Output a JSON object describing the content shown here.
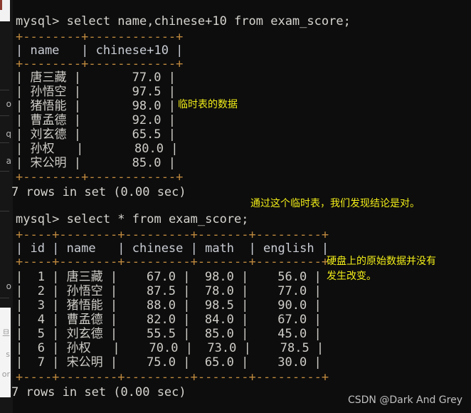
{
  "terminal": {
    "prompt": "mysql> ",
    "query1": "select name,chinese+10 from exam_score;",
    "query2": "select * from exam_score;",
    "status1": "7 rows in set (0.00 sec)",
    "status2": "7 rows in set (0.00 sec)"
  },
  "table1": {
    "top_rule": "+--------+------------+",
    "header_row": "| name   | chinese+10 |",
    "mid_rule": "+--------+------------+",
    "bottom_rule": "+--------+------------+",
    "headers": [
      "name",
      "chinese+10"
    ],
    "rows": [
      {
        "line": "| 唐三藏 |       77.0 |",
        "name": "唐三藏",
        "value": "77.0"
      },
      {
        "line": "| 孙悟空 |       97.5 |",
        "name": "孙悟空",
        "value": "97.5"
      },
      {
        "line": "| 猪悟能 |       98.0 |",
        "name": "猪悟能",
        "value": "98.0"
      },
      {
        "line": "| 曹孟德 |       92.0 |",
        "name": "曹孟德",
        "value": "92.0"
      },
      {
        "line": "| 刘玄德 |       65.5 |",
        "name": "刘玄德",
        "value": "65.5"
      },
      {
        "line": "| 孙权   |       80.0 |",
        "name": "孙权",
        "value": "80.0"
      },
      {
        "line": "| 宋公明 |       85.0 |",
        "name": "宋公明",
        "value": "85.0"
      }
    ]
  },
  "table2": {
    "top_rule": "+----+--------+---------+-------+---------+",
    "header_row": "| id | name   | chinese | math  | english |",
    "mid_rule": "+----+--------+---------+-------+---------+",
    "bottom_rule": "+----+--------+---------+-------+---------+",
    "headers": [
      "id",
      "name",
      "chinese",
      "math",
      "english"
    ],
    "rows": [
      {
        "line": "|  1 | 唐三藏 |    67.0 |  98.0 |    56.0 |",
        "id": "1",
        "name": "唐三藏",
        "chinese": "67.0",
        "math": "98.0",
        "english": "56.0"
      },
      {
        "line": "|  2 | 孙悟空 |    87.5 |  78.0 |    77.0 |",
        "id": "2",
        "name": "孙悟空",
        "chinese": "87.5",
        "math": "78.0",
        "english": "77.0"
      },
      {
        "line": "|  3 | 猪悟能 |    88.0 |  98.5 |    90.0 |",
        "id": "3",
        "name": "猪悟能",
        "chinese": "88.0",
        "math": "98.5",
        "english": "90.0"
      },
      {
        "line": "|  4 | 曹孟德 |    82.0 |  84.0 |    67.0 |",
        "id": "4",
        "name": "曹孟德",
        "chinese": "82.0",
        "math": "84.0",
        "english": "67.0"
      },
      {
        "line": "|  5 | 刘玄德 |    55.5 |  85.0 |    45.0 |",
        "id": "5",
        "name": "刘玄德",
        "chinese": "55.5",
        "math": "85.0",
        "english": "45.0"
      },
      {
        "line": "|  6 | 孙权   |    70.0 |  73.0 |    78.5 |",
        "id": "6",
        "name": "孙权",
        "chinese": "70.0",
        "math": "73.0",
        "english": "78.5"
      },
      {
        "line": "|  7 | 宋公明 |    75.0 |  65.0 |    30.0 |",
        "id": "7",
        "name": "宋公明",
        "chinese": "75.0",
        "math": "65.0",
        "english": "30.0"
      }
    ]
  },
  "annotations": {
    "note1": "临时表的数据",
    "note2": "通过这个临时表，我们发现结论是对。",
    "note3_line1": "硬盘上的原始数据并没有",
    "note3_line2": "发生改变。"
  },
  "watermark": "CSDN @Dark And Grey",
  "background_fragments": {
    "chips": [
      "o",
      "q",
      "a"
    ],
    "panel_chips": [
      "旦",
      "s",
      "or"
    ]
  },
  "colors": {
    "background": "#0d0d0d",
    "text": "#d4d2cd",
    "rule": "#c08a3e",
    "note": "#f2ee18",
    "watermark": "#cfcfcf"
  }
}
